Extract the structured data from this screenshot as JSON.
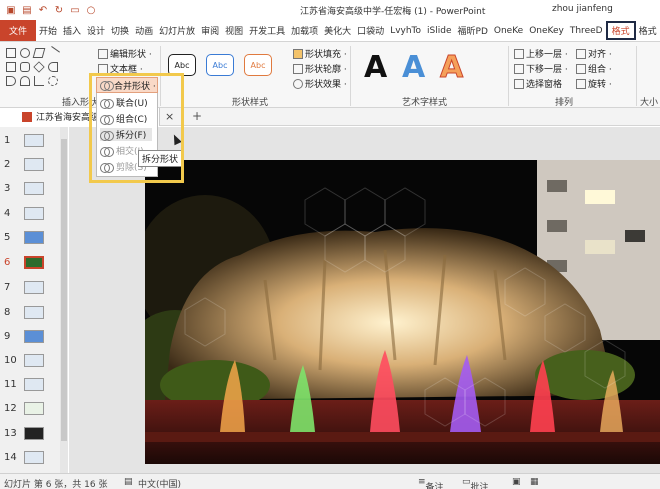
{
  "titlebar": {
    "doc_title": "江苏省海安高级中学-任宏梅 (1)  -  PowerPoint",
    "user": "zhou jianfeng"
  },
  "tabs": [
    {
      "label": "文件"
    },
    {
      "label": "开始"
    },
    {
      "label": "插入"
    },
    {
      "label": "设计"
    },
    {
      "label": "切换"
    },
    {
      "label": "动画"
    },
    {
      "label": "幻灯片放"
    },
    {
      "label": "审阅"
    },
    {
      "label": "视图"
    },
    {
      "label": "开发工具"
    },
    {
      "label": "加载项"
    },
    {
      "label": "美化大"
    },
    {
      "label": "口袋动"
    },
    {
      "label": "LvyhTo"
    },
    {
      "label": "iSlide"
    },
    {
      "label": "福昕PD"
    },
    {
      "label": "OneKe"
    },
    {
      "label": "OneKey"
    },
    {
      "label": "ThreeD"
    },
    {
      "label": "格式"
    },
    {
      "label": "格式"
    }
  ],
  "ribbon": {
    "edit_shape": "编辑形状 ·",
    "text_box": "文本框 ·",
    "merge_shapes": "合并形状 ·",
    "insert_shapes_label": "插入形状",
    "shape_styles_label": "形状样式",
    "style_sample": "Abc",
    "shape_fill": "形状填充 ·",
    "shape_outline": "形状轮廓 ·",
    "shape_effects": "形状效果 ·",
    "wordart_label": "艺术字样式",
    "wordart_sample": "A",
    "bring_forward": "上移一层 ·",
    "send_backward": "下移一层 ·",
    "selection_pane": "选择窗格",
    "align": "对齐 ·",
    "group": "组合 ·",
    "rotate": "旋转 ·",
    "arrange_label": "排列",
    "size_label": "大小"
  },
  "merge_menu": {
    "items": [
      {
        "label": "联合(U)"
      },
      {
        "label": "组合(C)"
      },
      {
        "label": "拆分(F)"
      },
      {
        "label": "相交(I)"
      },
      {
        "label": "剪除(S)"
      }
    ],
    "tooltip": "拆分形状"
  },
  "doctab": {
    "label": "江苏省海安高级中学-..."
  },
  "thumbnails": [
    {
      "num": "1"
    },
    {
      "num": "2"
    },
    {
      "num": "3"
    },
    {
      "num": "4"
    },
    {
      "num": "5"
    },
    {
      "num": "6"
    },
    {
      "num": "7"
    },
    {
      "num": "8"
    },
    {
      "num": "9"
    },
    {
      "num": "10"
    },
    {
      "num": "11"
    },
    {
      "num": "12"
    },
    {
      "num": "13"
    },
    {
      "num": "14"
    }
  ],
  "status": {
    "slide_info": "幻灯片 第 6 张，共 16 张",
    "language": "中文(中国)",
    "notes": "备注",
    "comments": "批注"
  },
  "colors": {
    "accent": "#c9442b",
    "highlight": "#f2c94c"
  }
}
